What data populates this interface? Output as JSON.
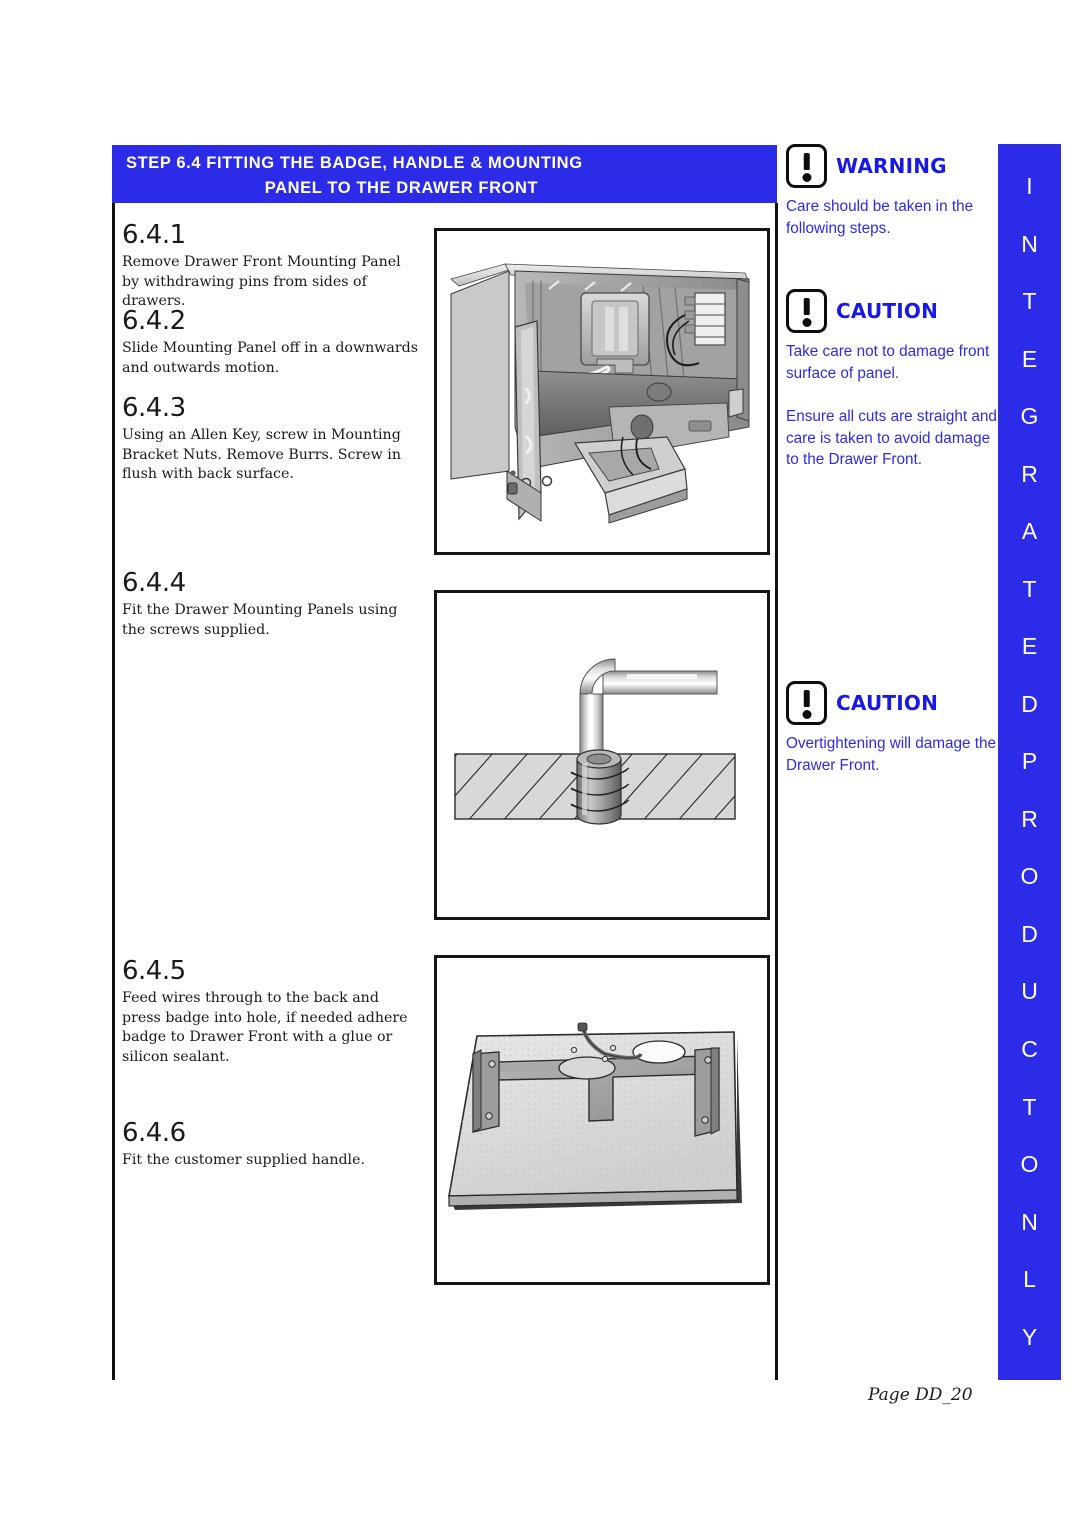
{
  "header": {
    "line1": "STEP 6.4   FITTING  THE  BADGE,  HANDLE   &  MOUNTING",
    "line2": "PANEL  TO THE DRAWER FRONT",
    "bar_color": "#2B2BE8"
  },
  "steps": [
    {
      "number": "6.4.1",
      "text": "Remove Drawer Front Mounting Panel by withdrawing pins from sides of drawers."
    },
    {
      "number": "6.4.2",
      "text": "Slide Mounting Panel off in a downwards and outwards motion."
    },
    {
      "number": "6.4.3",
      "text": "Using an Allen Key, screw in Mounting Bracket Nuts.  Remove Burrs.  Screw in flush with back surface."
    },
    {
      "number": "6.4.4",
      "text": "Fit the Drawer Mounting Panels using the screws supplied."
    },
    {
      "number": "6.4.5",
      "text": "Feed wires through to the back and press badge into hole, if needed adhere badge to Drawer Front with a glue or silicon sealant."
    },
    {
      "number": "6.4.6",
      "text": "Fit the customer supplied handle."
    }
  ],
  "illustrations": [
    {
      "name": "drawer-front-assembly-cutaway"
    },
    {
      "name": "allen-key-in-threaded-insert"
    },
    {
      "name": "drawer-front-with-mounting-bracket"
    }
  ],
  "notices": [
    {
      "icon": "exclamation-icon",
      "title": "WARNING",
      "paragraphs": [
        "Care should be taken in the following steps."
      ]
    },
    {
      "icon": "exclamation-icon",
      "title": "CAUTION",
      "paragraphs": [
        "Take care not to damage front surface of panel.",
        "Ensure all cuts are straight and care is taken to avoid damage to the Drawer Front."
      ]
    },
    {
      "icon": "exclamation-icon",
      "title": "CAUTION",
      "paragraphs": [
        "Overtightening will damage the Drawer Front."
      ]
    }
  ],
  "vertical_strip": {
    "text": "INTEGRATED PRODUCT ONLY",
    "letters": [
      "I",
      "N",
      "T",
      "E",
      "G",
      "R",
      "A",
      "T",
      "E",
      "D",
      "P",
      "R",
      "O",
      "D",
      "U",
      "C",
      "T",
      "O",
      "N",
      "L",
      "Y"
    ],
    "color": "#2B2BE8"
  },
  "footer": {
    "page_label": "Page DD_20"
  },
  "notice_text_color": "#2B2BE8"
}
